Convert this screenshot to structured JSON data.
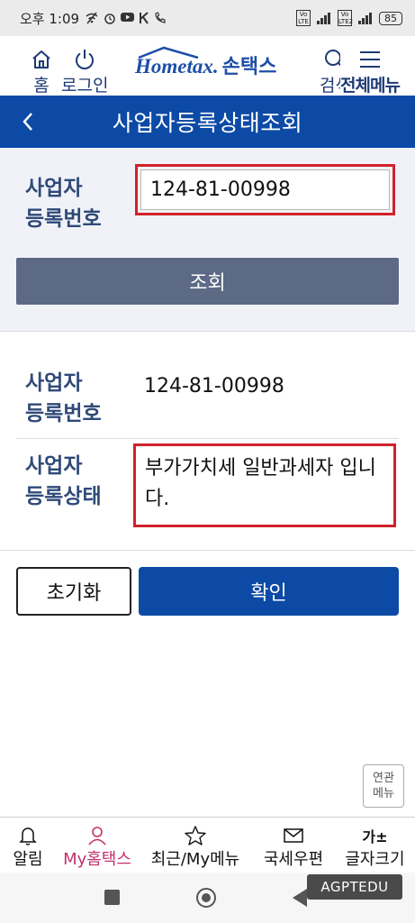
{
  "status_bar": {
    "time": "오후 1:09",
    "icons": [
      "wifi-off-icon",
      "alarm-icon",
      "youtube-icon",
      "k-icon",
      "call-icon"
    ],
    "network_left": "Vo LTE",
    "network_right": "Vo LTE2",
    "battery": "85"
  },
  "header": {
    "home_label": "홈",
    "login_label": "로그인",
    "logo_en": "Hometax.",
    "logo_ko": "손택스",
    "search_label": "검색",
    "menu_label": "전체메뉴"
  },
  "title_bar": {
    "title": "사업자등록상태조회"
  },
  "search": {
    "label_line1": "사업자",
    "label_line2": "등록번호",
    "input_value": "124-81-00998",
    "lookup_button": "조회"
  },
  "result": {
    "number_label_line1": "사업자",
    "number_label_line2": "등록번호",
    "number_value": "124-81-00998",
    "status_label_line1": "사업자",
    "status_label_line2": "등록상태",
    "status_value": "부가가치세 일반과세자 입니다."
  },
  "actions": {
    "reset_button": "초기화",
    "confirm_button": "확인"
  },
  "related_menu": {
    "line1": "연관",
    "line2": "메뉴"
  },
  "bottom_nav": {
    "items": [
      {
        "label": "알림",
        "icon": "bell-icon"
      },
      {
        "label": "My홈택스",
        "icon": "user-icon",
        "active": true
      },
      {
        "label": "최근/My메뉴",
        "icon": "star-icon"
      },
      {
        "label": "국세우편",
        "icon": "mail-icon"
      },
      {
        "label": "글자크기",
        "icon": "font-size-icon",
        "icon_text": "가±"
      }
    ]
  },
  "watermark": "AGPTEDU",
  "colors": {
    "primary": "#0c4aa6",
    "highlight_border": "#d1222b",
    "lookup_button": "#5c6a85",
    "label_text": "#2f4a78",
    "active_nav": "#c3306a"
  }
}
